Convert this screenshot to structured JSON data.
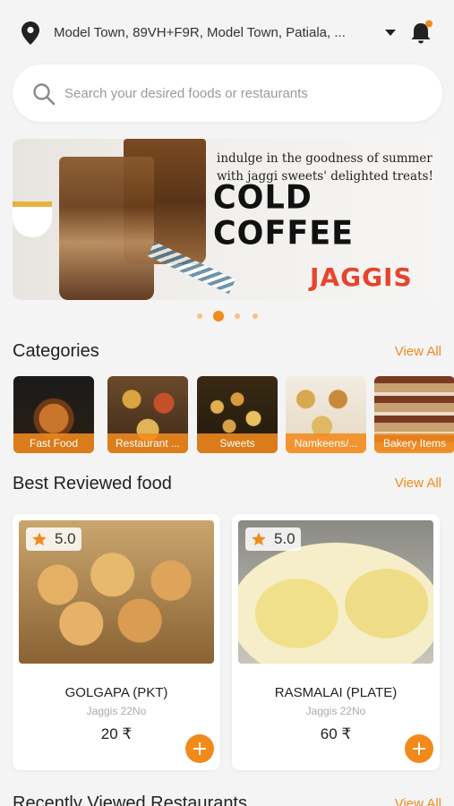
{
  "header": {
    "location_icon": "map-pin-icon",
    "address": "Model Town, 89VH+F9R, Model Town, Patiala, ...",
    "dropdown_icon": "caret-down-icon",
    "notification_icon": "bell-icon",
    "notification_dot_color": "#f28a1b"
  },
  "search": {
    "icon": "search-icon",
    "placeholder": "Search your desired foods or restaurants"
  },
  "banner": {
    "tagline_line1": "indulge in the goodness of summer",
    "tagline_line2": "with jaggi sweets' delighted treats!",
    "headline_line1": "COLD",
    "headline_line2": "COFFEE",
    "brand": "JAGGIS",
    "brand_color": "#e5452c",
    "page_count": 4,
    "active_page": 2
  },
  "categories": {
    "title": "Categories",
    "view_all": "View All",
    "items": [
      {
        "label": "Fast Food"
      },
      {
        "label": "Restaurant ..."
      },
      {
        "label": "Sweets"
      },
      {
        "label": "Namkeens/..."
      },
      {
        "label": "Bakery Items"
      }
    ]
  },
  "best_reviewed": {
    "title": "Best Reviewed food",
    "view_all": "View All",
    "items": [
      {
        "rating": "5.0",
        "name": "GOLGAPA (PKT)",
        "restaurant": "Jaggis 22No",
        "price": "20 ₹"
      },
      {
        "rating": "5.0",
        "name": "RASMALAI (PLATE)",
        "restaurant": "Jaggis 22No",
        "price": "60 ₹"
      }
    ]
  },
  "recently_viewed": {
    "title": "Recently Viewed Restaurants",
    "view_all": "View All"
  },
  "colors": {
    "accent": "#f28a1b",
    "background": "#f4f4f4"
  }
}
